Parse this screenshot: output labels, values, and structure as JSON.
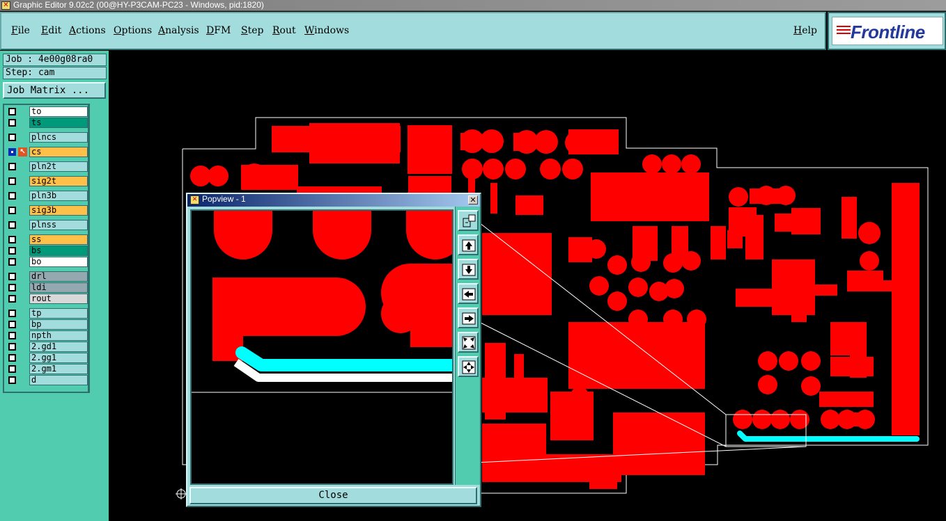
{
  "window": {
    "title": "Graphic Editor 9.02c2 (00@HY-P3CAM-PC23 - Windows, pid:1820)"
  },
  "menu": {
    "items": [
      "File",
      "Edit",
      "Actions",
      "Options",
      "Analysis",
      "DFM",
      "Step",
      "Rout",
      "Windows"
    ],
    "help": "Help"
  },
  "brand": {
    "name": "Frontline"
  },
  "job": {
    "job_label": "Job : 4e00g08ra0",
    "step_label": "Step: cam",
    "matrix_button": "Job Matrix ..."
  },
  "layers": [
    {
      "name": "to",
      "color": "#ffffff"
    },
    {
      "name": "ts",
      "color": "#00997a"
    },
    {
      "name": "plncs",
      "color": "#a2dcdc"
    },
    {
      "name": "cs",
      "color": "#ffc04a",
      "active": true
    },
    {
      "name": "pln2t",
      "color": "#a2dcdc"
    },
    {
      "name": "sig2t",
      "color": "#ffc04a"
    },
    {
      "name": "pln3b",
      "color": "#a2dcdc"
    },
    {
      "name": "sig3b",
      "color": "#ffc04a"
    },
    {
      "name": "plnss",
      "color": "#a2dcdc"
    },
    {
      "name": "ss",
      "color": "#ffc04a"
    },
    {
      "name": "bs",
      "color": "#00997a"
    },
    {
      "name": "bo",
      "color": "#ffffff"
    },
    {
      "name": "drl",
      "color": "#94a8b0"
    },
    {
      "name": "ldi",
      "color": "#94a8b0"
    },
    {
      "name": "rout",
      "color": "#d8d8d8"
    },
    {
      "name": "tp",
      "color": "#a2dcdc"
    },
    {
      "name": "bp",
      "color": "#a2dcdc"
    },
    {
      "name": "npth",
      "color": "#a2dcdc"
    },
    {
      "name": "2.gd1",
      "color": "#a2dcdc"
    },
    {
      "name": "2.gg1",
      "color": "#a2dcdc"
    },
    {
      "name": "2.gm1",
      "color": "#a2dcdc"
    },
    {
      "name": "d",
      "color": "#a2dcdc"
    }
  ],
  "popview": {
    "title": "Popview - 1",
    "close_x": "✕",
    "close_button": "Close",
    "tools": [
      "zoom-fit-icon",
      "pan-up-icon",
      "pan-down-icon",
      "pan-left-icon",
      "pan-right-icon",
      "zoom-in-icon",
      "zoom-out-icon"
    ]
  },
  "colors": {
    "copper": "#ff0000",
    "highlight": "#00ffff",
    "panel": "#a2dcdc",
    "panel_dark": "#52ccae",
    "outline": "#ffffff"
  }
}
